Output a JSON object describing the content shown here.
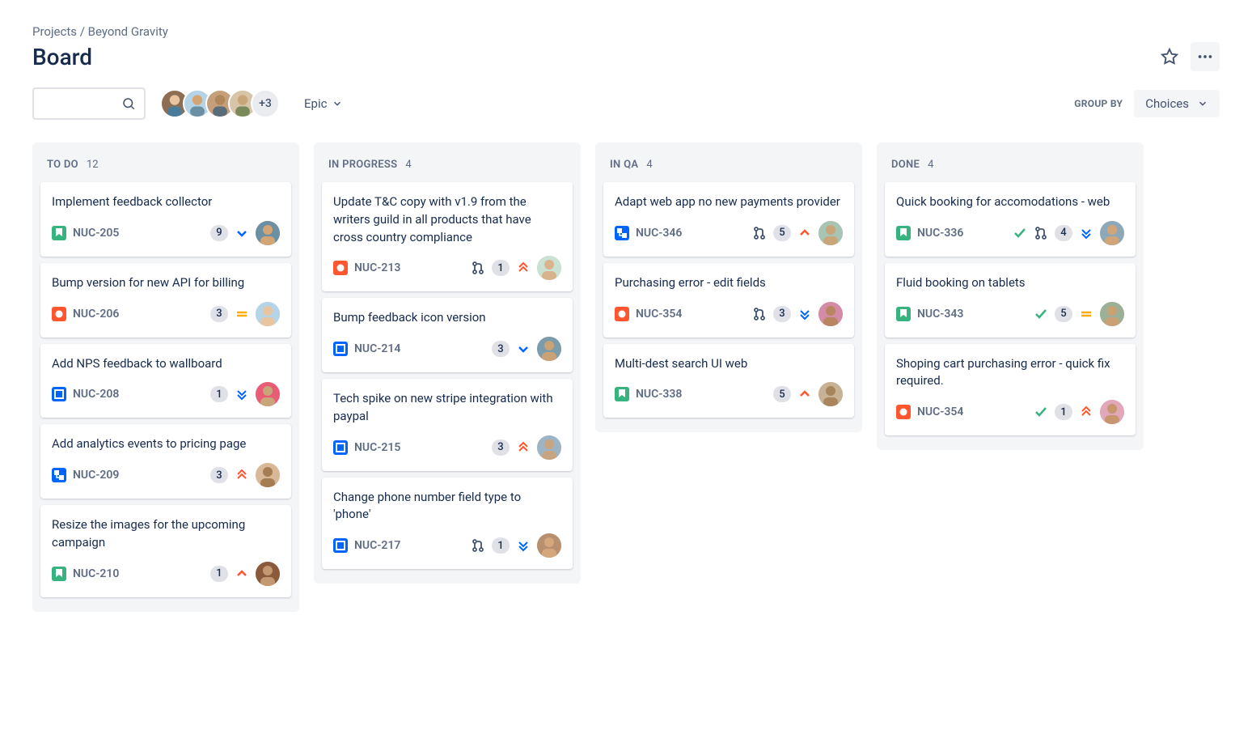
{
  "breadcrumb": {
    "root": "Projects",
    "project": "Beyond Gravity"
  },
  "title": "Board",
  "avatars_more": "+3",
  "filter": {
    "epic": "Epic"
  },
  "group_by": {
    "label": "GROUP BY",
    "value": "Choices"
  },
  "columns": [
    {
      "title": "TO DO",
      "count": "12",
      "cards": [
        {
          "title": "Implement feedback collector",
          "type": "story",
          "id": "NUC-205",
          "sp": "9",
          "priority": "low",
          "avatar": 0
        },
        {
          "title": "Bump version for new API for billing",
          "type": "bug",
          "id": "NUC-206",
          "sp": "3",
          "priority": "medium",
          "avatar": 1
        },
        {
          "title": "Add NPS feedback to wallboard",
          "type": "task",
          "id": "NUC-208",
          "sp": "1",
          "priority": "lowest",
          "avatar": 2
        },
        {
          "title": "Add analytics events to pricing page",
          "type": "subtask",
          "id": "NUC-209",
          "sp": "3",
          "priority": "highest",
          "avatar": 3
        },
        {
          "title": "Resize the images for the upcoming campaign",
          "type": "story",
          "id": "NUC-210",
          "sp": "1",
          "priority": "high",
          "avatar": 4
        }
      ]
    },
    {
      "title": "IN PROGRESS",
      "count": "4",
      "cards": [
        {
          "title": "Update T&C copy with v1.9 from the writers guild in all products that have cross country compliance",
          "type": "bug",
          "id": "NUC-213",
          "pr": true,
          "sp": "1",
          "priority": "highest",
          "avatar": 5
        },
        {
          "title": "Bump feedback icon version",
          "type": "task",
          "id": "NUC-214",
          "sp": "3",
          "priority": "low",
          "avatar": 6
        },
        {
          "title": "Tech spike on new stripe integration with paypal",
          "type": "task",
          "id": "NUC-215",
          "sp": "3",
          "priority": "highest",
          "avatar": 7
        },
        {
          "title": "Change phone number field type to 'phone'",
          "type": "task",
          "id": "NUC-217",
          "pr": true,
          "sp": "1",
          "priority": "lowest",
          "avatar": 8
        }
      ]
    },
    {
      "title": "IN QA",
      "count": "4",
      "cards": [
        {
          "title": "Adapt web app no new payments provider",
          "type": "subtask",
          "id": "NUC-346",
          "pr": true,
          "sp": "5",
          "priority": "high",
          "avatar": 9
        },
        {
          "title": "Purchasing error - edit fields",
          "type": "bug",
          "id": "NUC-354",
          "pr": true,
          "sp": "3",
          "priority": "lowest",
          "avatar": 10
        },
        {
          "title": "Multi-dest search UI web",
          "type": "story",
          "id": "NUC-338",
          "sp": "5",
          "priority": "high",
          "avatar": 11
        }
      ]
    },
    {
      "title": "DONE",
      "count": "4",
      "cards": [
        {
          "title": "Quick booking for accomodations - web",
          "type": "story",
          "id": "NUC-336",
          "done": true,
          "pr": true,
          "sp": "4",
          "priority": "lowest",
          "avatar": 12
        },
        {
          "title": "Fluid booking on tablets",
          "type": "story",
          "id": "NUC-343",
          "done": true,
          "sp": "5",
          "priority": "medium",
          "avatar": 13
        },
        {
          "title": "Shoping cart purchasing error - quick fix required.",
          "type": "bug",
          "id": "NUC-354",
          "done": true,
          "sp": "1",
          "priority": "highest",
          "avatar": 14
        }
      ]
    }
  ]
}
